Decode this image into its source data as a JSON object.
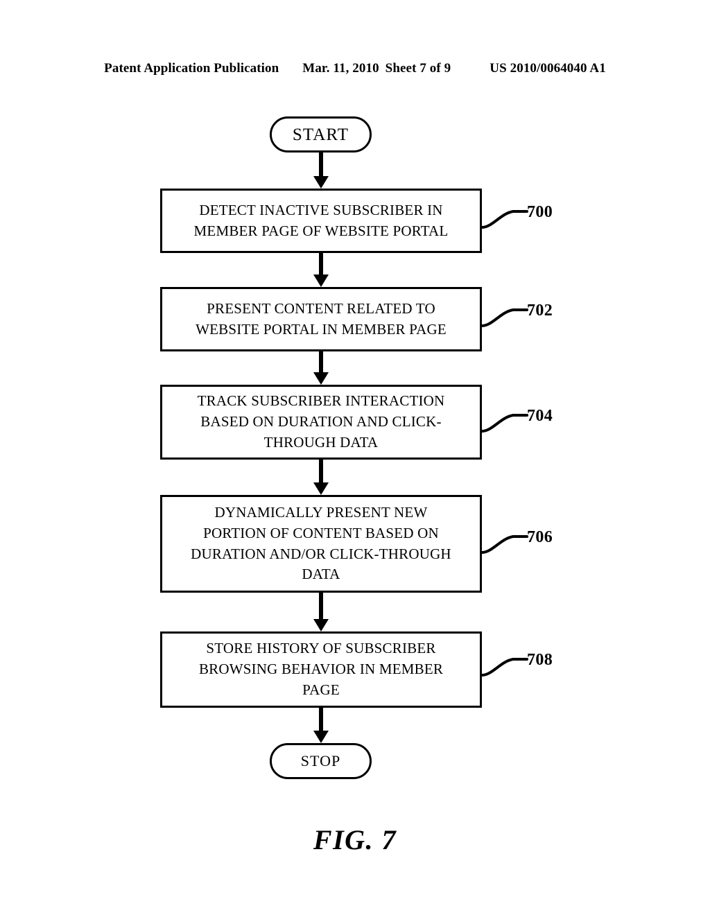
{
  "header": {
    "publication": "Patent Application Publication",
    "date": "Mar. 11, 2010",
    "sheet": "Sheet 7 of 9",
    "patent_number": "US 2010/0064040 A1"
  },
  "figure": {
    "caption": "FIG. 7",
    "type": "flowchart"
  },
  "flowchart": {
    "nodes": [
      {
        "id": "start",
        "shape": "terminator",
        "label": "START"
      },
      {
        "id": "700",
        "shape": "process",
        "ref": "700",
        "label": "DETECT INACTIVE SUBSCRIBER IN\nMEMBER PAGE OF WEBSITE PORTAL"
      },
      {
        "id": "702",
        "shape": "process",
        "ref": "702",
        "label": "PRESENT CONTENT RELATED TO\nWEBSITE PORTAL IN MEMBER PAGE"
      },
      {
        "id": "704",
        "shape": "process",
        "ref": "704",
        "label": "TRACK SUBSCRIBER INTERACTION\nBASED ON DURATION AND CLICK-\nTHROUGH DATA"
      },
      {
        "id": "706",
        "shape": "process",
        "ref": "706",
        "label": "DYNAMICALLY PRESENT NEW\nPORTION OF CONTENT BASED ON\nDURATION AND/OR CLICK-THROUGH\nDATA"
      },
      {
        "id": "708",
        "shape": "process",
        "ref": "708",
        "label": "STORE HISTORY OF SUBSCRIBER\nBROWSING BEHAVIOR IN MEMBER\nPAGE"
      },
      {
        "id": "stop",
        "shape": "terminator",
        "label": "STOP"
      }
    ],
    "edges": [
      {
        "from": "start",
        "to": "700",
        "style": "arrow"
      },
      {
        "from": "700",
        "to": "702",
        "style": "arrow"
      },
      {
        "from": "702",
        "to": "704",
        "style": "arrow"
      },
      {
        "from": "704",
        "to": "706",
        "style": "arrow"
      },
      {
        "from": "706",
        "to": "708",
        "style": "arrow"
      },
      {
        "from": "708",
        "to": "stop",
        "style": "arrow"
      }
    ],
    "reference_numerals": [
      "700",
      "702",
      "704",
      "706",
      "708"
    ]
  },
  "colors": {
    "ink": "#000000",
    "paper": "#ffffff"
  }
}
